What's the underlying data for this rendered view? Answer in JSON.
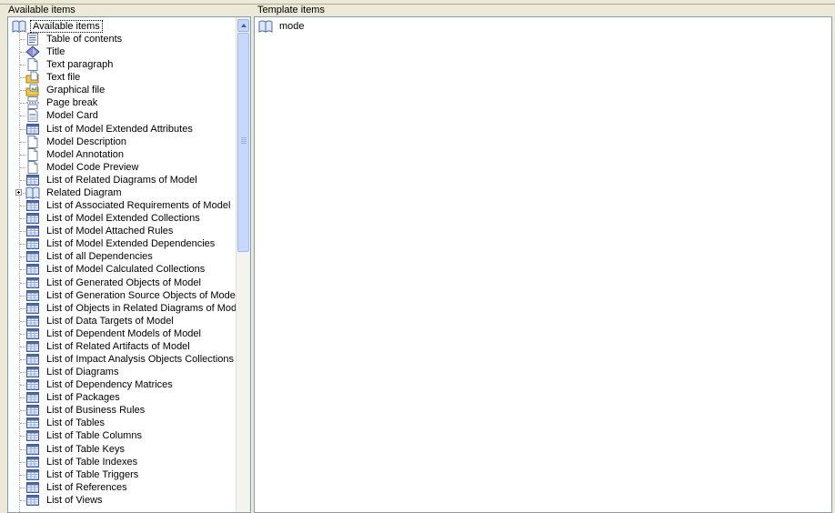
{
  "left_panel": {
    "title": "Available items",
    "root": {
      "label": "Available items",
      "icon": "book-icon"
    },
    "items": [
      {
        "label": "Table of contents",
        "icon": "toc-icon"
      },
      {
        "label": "Title",
        "icon": "title-diamond-icon"
      },
      {
        "label": "Text paragraph",
        "icon": "document-icon"
      },
      {
        "label": "Text file",
        "icon": "folder-document-icon"
      },
      {
        "label": "Graphical file",
        "icon": "folder-image-icon"
      },
      {
        "label": "Page break",
        "icon": "page-break-icon"
      },
      {
        "label": "Model Card",
        "icon": "card-icon"
      },
      {
        "label": "List of Model Extended Attributes",
        "icon": "list-icon"
      },
      {
        "label": "Model Description",
        "icon": "document-icon"
      },
      {
        "label": "Model Annotation",
        "icon": "document-icon"
      },
      {
        "label": "Model Code Preview",
        "icon": "document-icon"
      },
      {
        "label": "List of Related Diagrams of Model",
        "icon": "list-icon"
      },
      {
        "label": "Related Diagram",
        "icon": "book-icon",
        "expandable": true
      },
      {
        "label": "List of Associated Requirements of Model",
        "icon": "list-icon"
      },
      {
        "label": "List of Model Extended Collections",
        "icon": "list-icon"
      },
      {
        "label": "List of Model Attached Rules",
        "icon": "list-icon"
      },
      {
        "label": "List of Model Extended Dependencies",
        "icon": "list-icon"
      },
      {
        "label": "List of all Dependencies",
        "icon": "list-icon"
      },
      {
        "label": "List of Model Calculated Collections",
        "icon": "list-icon"
      },
      {
        "label": "List of Generated Objects of Model",
        "icon": "list-icon"
      },
      {
        "label": "List of Generation Source Objects of Model",
        "icon": "list-icon"
      },
      {
        "label": "List of Objects in Related Diagrams of Model",
        "icon": "list-icon"
      },
      {
        "label": "List of Data Targets of Model",
        "icon": "list-icon"
      },
      {
        "label": "List of Dependent Models of Model",
        "icon": "list-icon"
      },
      {
        "label": "List of Related Artifacts of Model",
        "icon": "list-icon"
      },
      {
        "label": "List of Impact Analysis Objects Collections of Mode",
        "icon": "list-icon"
      },
      {
        "label": "List of Diagrams",
        "icon": "list-icon"
      },
      {
        "label": "List of Dependency Matrices",
        "icon": "list-icon"
      },
      {
        "label": "List of Packages",
        "icon": "list-icon"
      },
      {
        "label": "List of Business Rules",
        "icon": "list-icon"
      },
      {
        "label": "List of Tables",
        "icon": "list-icon"
      },
      {
        "label": "List of Table Columns",
        "icon": "list-icon"
      },
      {
        "label": "List of Table Keys",
        "icon": "list-icon"
      },
      {
        "label": "List of Table Indexes",
        "icon": "list-icon"
      },
      {
        "label": "List of Table Triggers",
        "icon": "list-icon"
      },
      {
        "label": "List of References",
        "icon": "list-icon"
      },
      {
        "label": "List of Views",
        "icon": "list-icon"
      }
    ]
  },
  "right_panel": {
    "title": "Template items",
    "items": [
      {
        "label": "mode",
        "icon": "book-icon"
      }
    ]
  },
  "colors": {
    "window_bg": "#ece9d8",
    "border": "#7f9db9",
    "scroll_thumb": "#c8d7fb"
  }
}
